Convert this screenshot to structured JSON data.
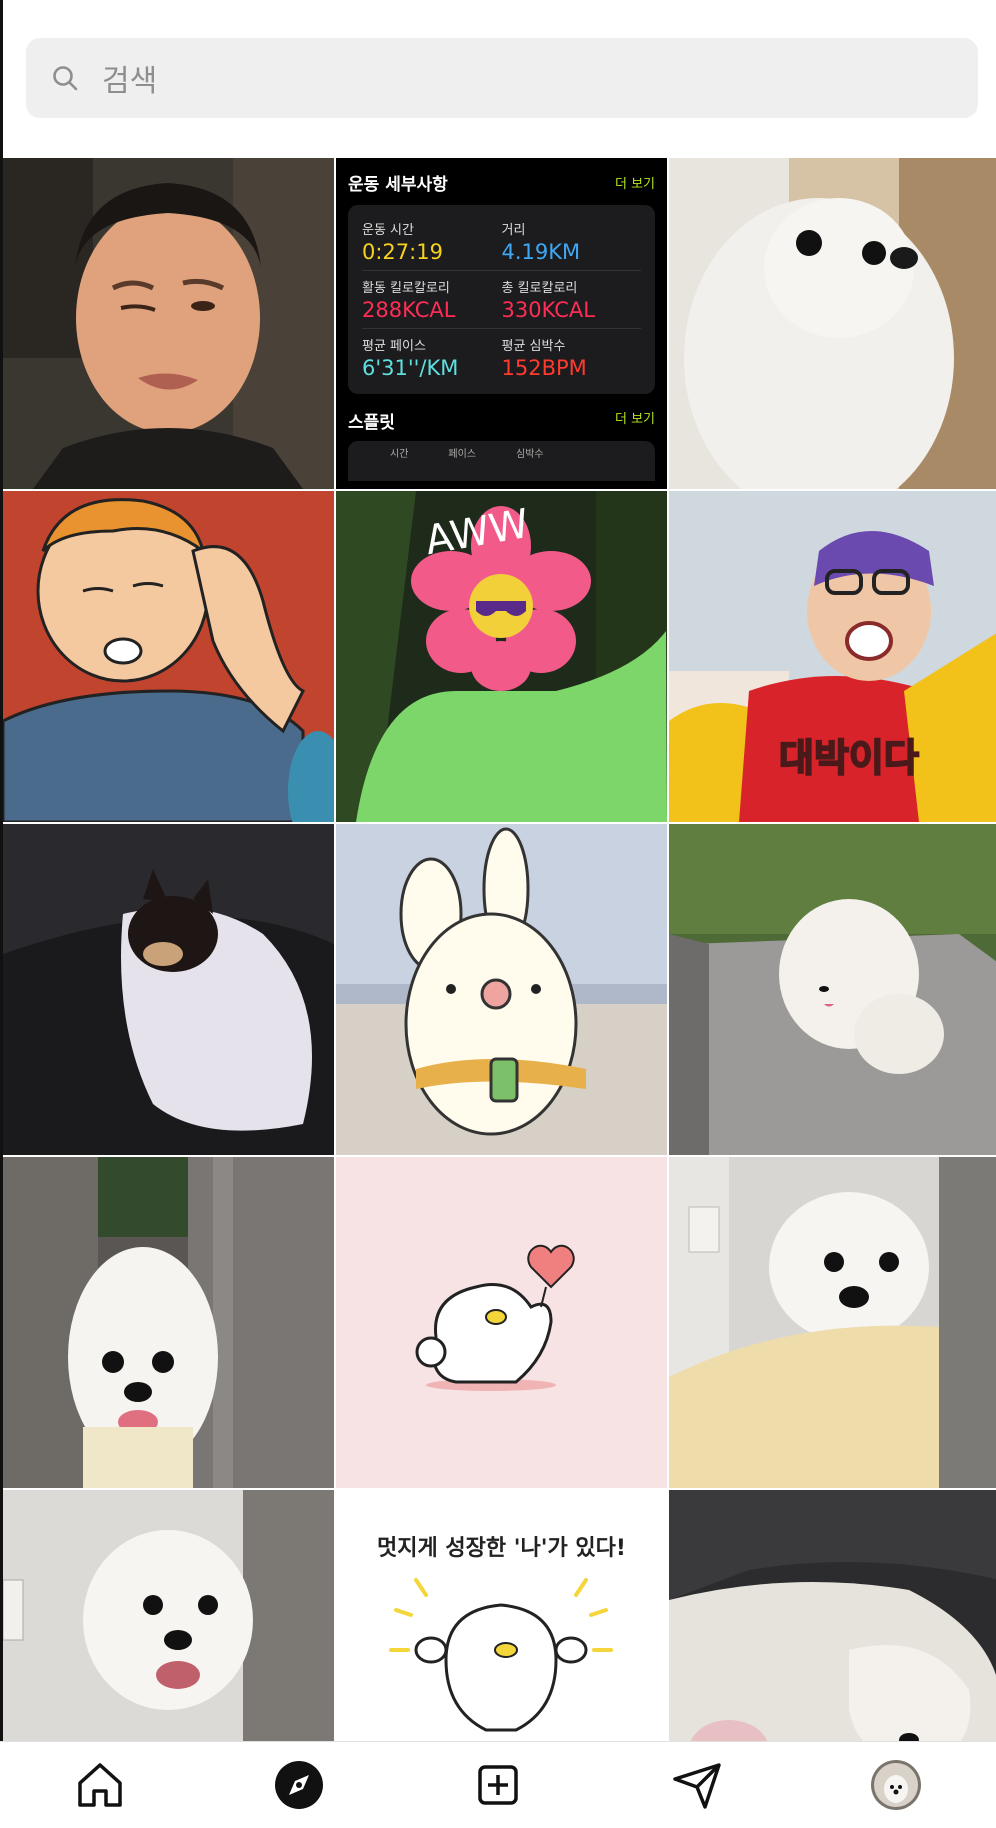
{
  "search": {
    "placeholder": "검색",
    "icon": "search-icon"
  },
  "workout": {
    "title": "운동 세부사항",
    "more": "더 보기",
    "stats": [
      {
        "label": "운동 시간",
        "value": "0:27:19",
        "color": "#f4d21f"
      },
      {
        "label": "거리",
        "value": "4.19KM",
        "color": "#3fa7f5"
      },
      {
        "label": "활동 킬로칼로리",
        "value": "288KCAL",
        "color": "#ff2d55"
      },
      {
        "label": "총 킬로칼로리",
        "value": "330KCAL",
        "color": "#ff2d55"
      },
      {
        "label": "평균 페이스",
        "value": "6'31''/KM",
        "color": "#5fe0e0"
      },
      {
        "label": "평균 심박수",
        "value": "152BPM",
        "color": "#ff3b30"
      }
    ],
    "splits_title": "스플릿",
    "splits_more": "더 보기",
    "split_headers": [
      "시간",
      "페이스",
      "심박수"
    ]
  },
  "grid": {
    "tiles": [
      {
        "name": "photo-man-squinting"
      },
      {
        "name": "workout-summary"
      },
      {
        "name": "photo-white-pomeranian"
      },
      {
        "name": "cartoon-bobby-hill"
      },
      {
        "name": "photo-flower-costume",
        "text": "AWW"
      },
      {
        "name": "photo-tv-show-woman",
        "text": "대박이다"
      },
      {
        "name": "photo-chihuahua-towel"
      },
      {
        "name": "cartoon-rabbit-phone"
      },
      {
        "name": "photo-pomeranian-on-stone"
      },
      {
        "name": "photo-pomeranian-door"
      },
      {
        "name": "cartoon-duck-heart"
      },
      {
        "name": "photo-pomeranian-cushion"
      },
      {
        "name": "photo-pomeranian-smiling"
      },
      {
        "name": "cartoon-duck-growing",
        "text": "멋지게 성장한 '나'가 있다!"
      },
      {
        "name": "photo-pomeranian-sleeping"
      }
    ]
  },
  "nav": {
    "items": [
      "home-icon",
      "explore-icon",
      "add-post-icon",
      "direct-message-icon",
      "profile-avatar"
    ]
  }
}
